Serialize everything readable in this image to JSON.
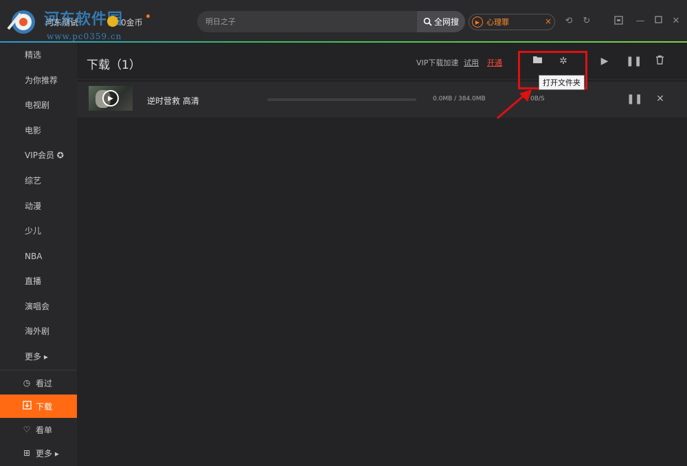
{
  "title_bar": {
    "watermark": "河东软件园",
    "watermark_url": "www.pc0359.cn",
    "user_name": "河东测试",
    "coin_label": "0金币",
    "search": {
      "placeholder": "明日之子",
      "button_label": "全网搜"
    },
    "hot_search": {
      "label": "心理罪",
      "close": "×"
    },
    "icons": [
      "history-icon",
      "refresh-icon",
      "mini-mode-icon",
      "minimize-icon",
      "maximize-icon",
      "close-icon"
    ]
  },
  "sidebar": {
    "items": [
      {
        "label": "精选"
      },
      {
        "label": "为你推荐"
      },
      {
        "label": "电视剧"
      },
      {
        "label": "电影"
      },
      {
        "label": "VIP会员 ✪"
      },
      {
        "label": "综艺"
      },
      {
        "label": "动漫"
      },
      {
        "label": "少儿"
      },
      {
        "label": "NBA"
      },
      {
        "label": "直播"
      },
      {
        "label": "演唱会"
      },
      {
        "label": "海外剧"
      },
      {
        "label": "更多 ▸"
      }
    ],
    "bottom": [
      {
        "label": "看过",
        "icon": "clock-icon"
      },
      {
        "label": "下载",
        "icon": "download-icon",
        "active": true
      },
      {
        "label": "看单",
        "icon": "heart-plus-icon"
      },
      {
        "label": "更多 ▸",
        "icon": "plus-square-icon"
      }
    ]
  },
  "main": {
    "page_title": "下载（1）",
    "vip_speed": "VIP下载加速",
    "trial_label": "试用",
    "open_vip_label": "开通",
    "tooltip": "打开文件夹",
    "accent_color": "#ff6a13",
    "downloads": [
      {
        "title": "逆时营救 高清",
        "size": "0.0MB / 384.0MB",
        "speed": "0B/S",
        "progress": 0
      }
    ]
  }
}
